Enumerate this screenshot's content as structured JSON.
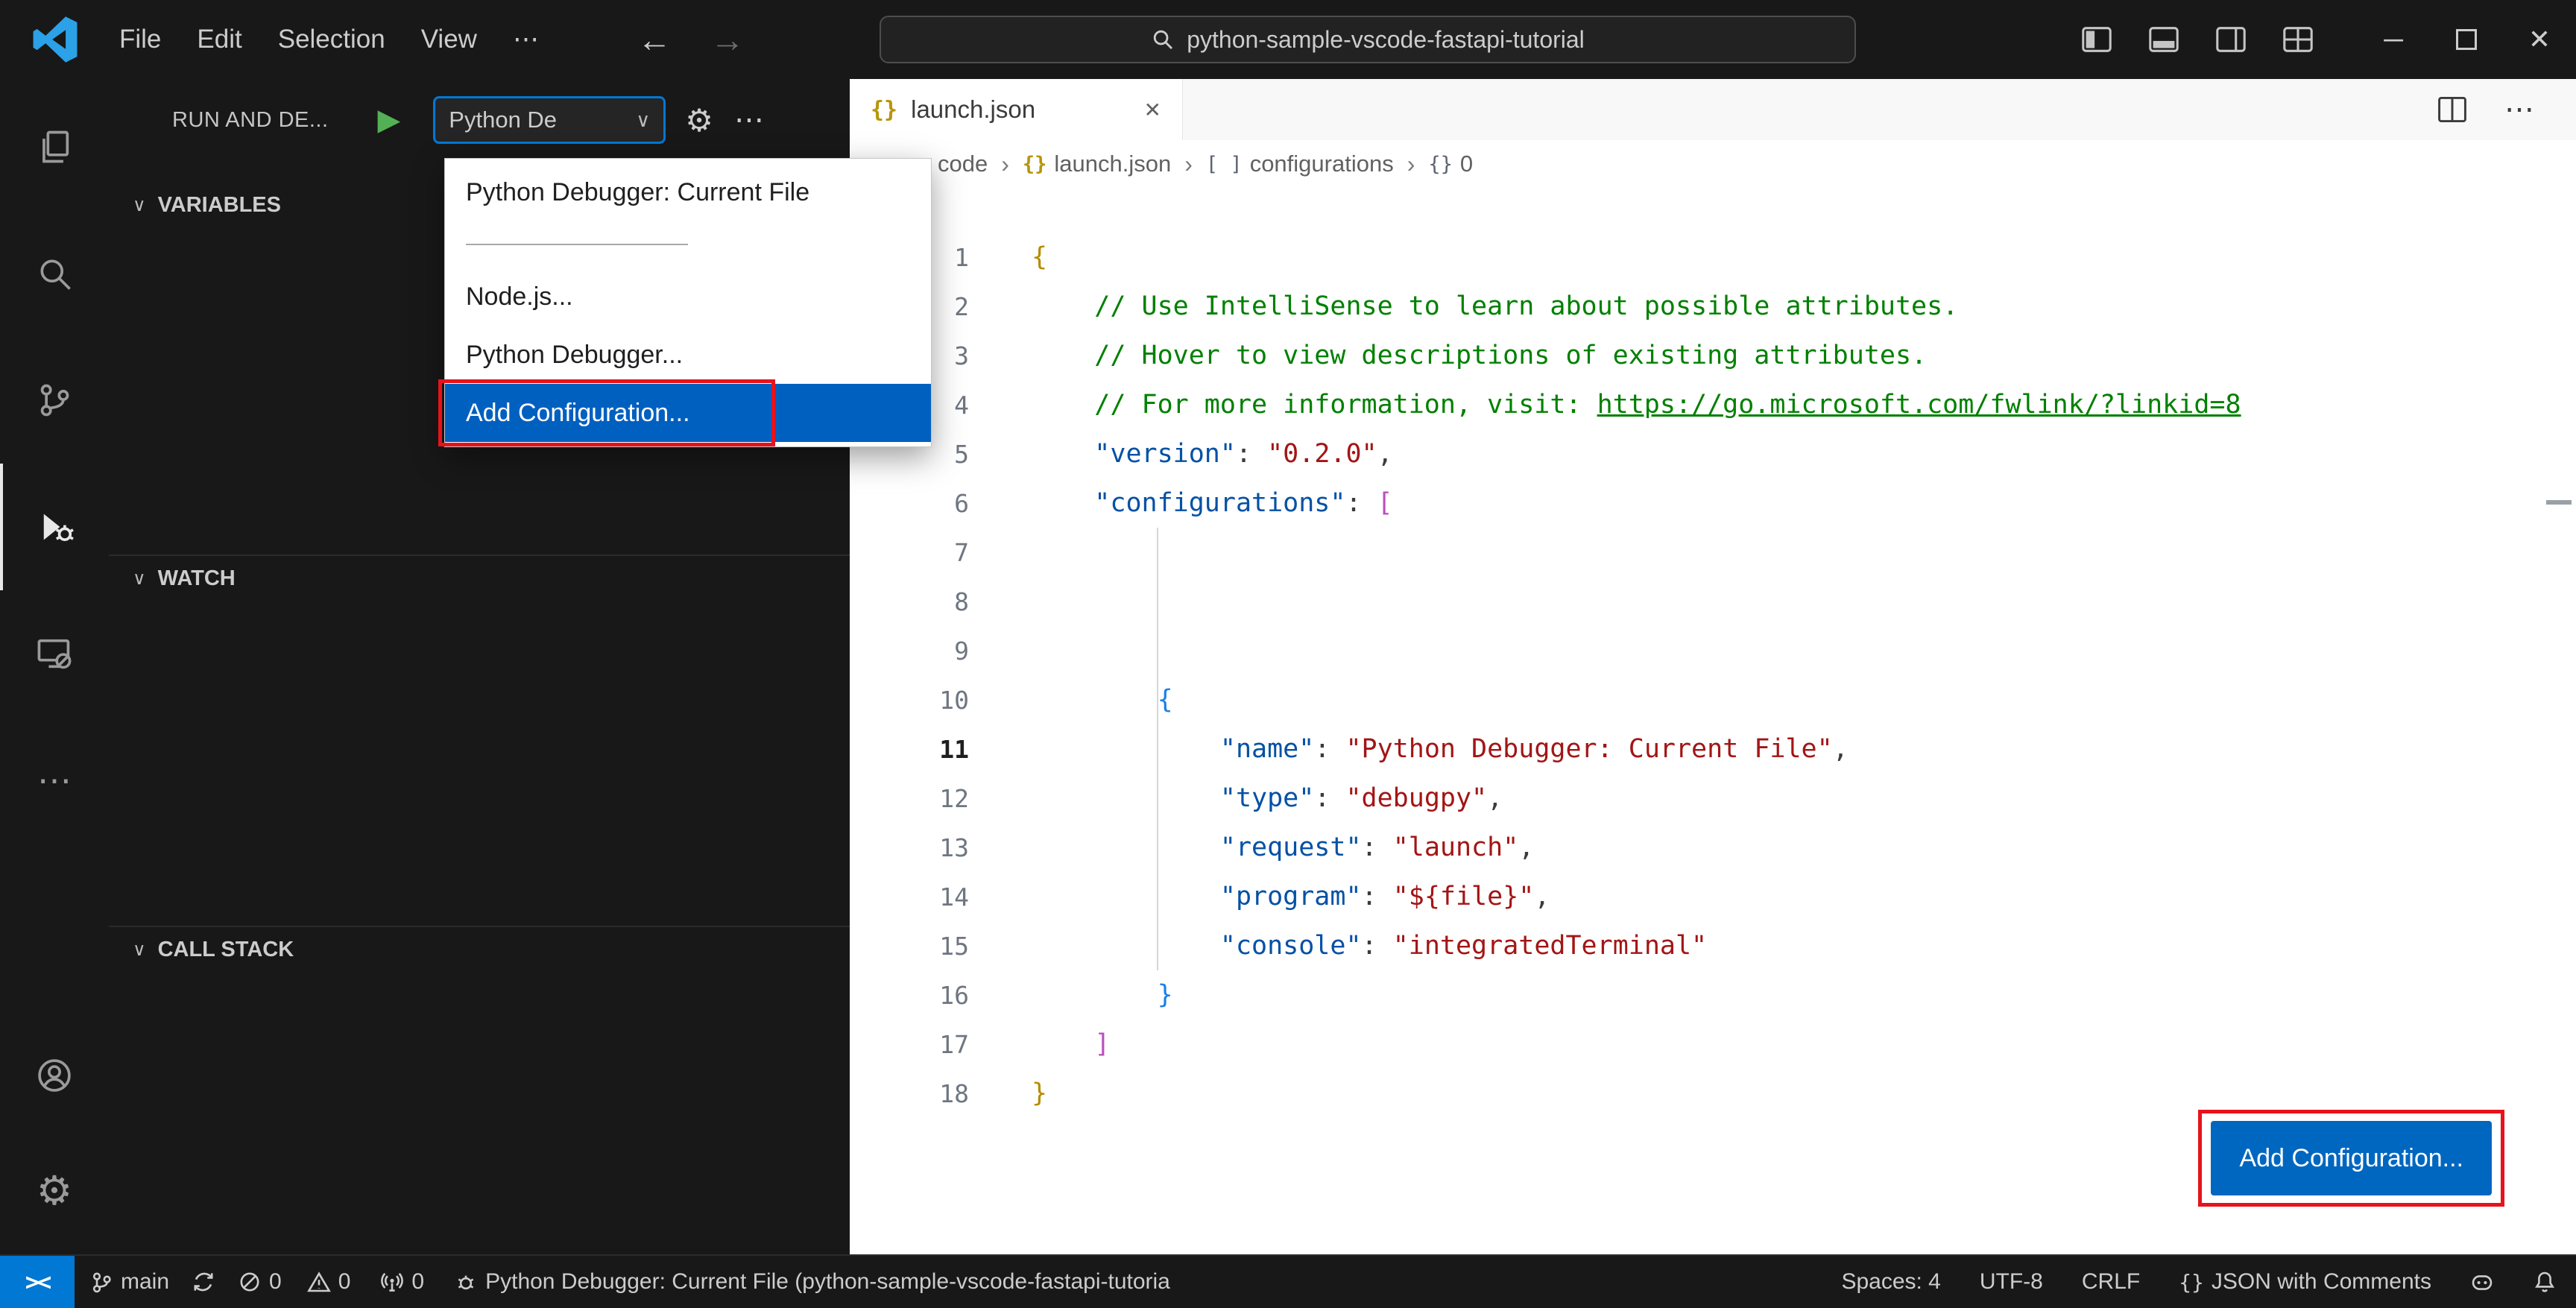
{
  "icons": {
    "more": "⋯",
    "back": "←",
    "forward": "→",
    "minimize": "─",
    "close": "✕",
    "chevron_down": "∨",
    "crumb_sep": "›",
    "braces": "{}",
    "brackets": "[ ]",
    "play": "▶",
    "gear": "⚙",
    "remote": "><",
    "close_tab": "✕"
  },
  "title_bar": {
    "menus": {
      "file": "File",
      "edit": "Edit",
      "selection": "Selection",
      "view": "View"
    },
    "search_value": "python-sample-vscode-fastapi-tutorial"
  },
  "sidebar": {
    "title": "RUN AND DE...",
    "select_value": "Python De",
    "variables": "VARIABLES",
    "watch": "WATCH",
    "call_stack": "CALL STACK"
  },
  "debug_dropdown": {
    "items": [
      {
        "type": "item",
        "label": "Python Debugger: Current File"
      },
      {
        "type": "separator"
      },
      {
        "type": "item",
        "label": "Node.js..."
      },
      {
        "type": "item",
        "label": "Python Debugger..."
      },
      {
        "type": "item",
        "label": "Add Configuration...",
        "selected": true,
        "annotated": true
      }
    ]
  },
  "editor": {
    "tab_label": "launch.json",
    "crumb1": "code",
    "crumb2": "launch.json",
    "crumb3": "configurations",
    "crumb4": "0",
    "add_button": "Add Configuration...",
    "code_lines": [
      {
        "n": "1",
        "tokens": [
          [
            "b1",
            "{"
          ]
        ]
      },
      {
        "n": "2",
        "tokens": [
          [
            "ws",
            "    "
          ],
          [
            "comment",
            "// Use IntelliSense to learn about possible attributes."
          ]
        ]
      },
      {
        "n": "3",
        "tokens": [
          [
            "ws",
            "    "
          ],
          [
            "comment",
            "// Hover to view descriptions of existing attributes."
          ]
        ]
      },
      {
        "n": "4",
        "tokens": [
          [
            "ws",
            "    "
          ],
          [
            "comment",
            "// For more information, visit: "
          ],
          [
            "link",
            "https://go.microsoft.com/fwlink/?linkid=8"
          ]
        ]
      },
      {
        "n": "5",
        "tokens": [
          [
            "ws",
            "    "
          ],
          [
            "key",
            "\"version\""
          ],
          [
            "punct",
            ": "
          ],
          [
            "str",
            "\"0.2.0\""
          ],
          [
            "punct",
            ","
          ]
        ]
      },
      {
        "n": "6",
        "tokens": [
          [
            "ws",
            "    "
          ],
          [
            "key",
            "\"configurations\""
          ],
          [
            "punct",
            ": "
          ],
          [
            "b2",
            "["
          ]
        ]
      },
      {
        "n": "7",
        "tokens": []
      },
      {
        "n": "8",
        "tokens": []
      },
      {
        "n": "9",
        "tokens": []
      },
      {
        "n": "10",
        "tokens": [
          [
            "ws",
            "        "
          ],
          [
            "b3",
            "{"
          ]
        ]
      },
      {
        "n": "11",
        "active": true,
        "tokens": [
          [
            "ws",
            "            "
          ],
          [
            "key",
            "\"name\""
          ],
          [
            "punct",
            ": "
          ],
          [
            "str",
            "\"Python Debugger: Current File\""
          ],
          [
            "punct",
            ","
          ]
        ]
      },
      {
        "n": "12",
        "tokens": [
          [
            "ws",
            "            "
          ],
          [
            "key",
            "\"type\""
          ],
          [
            "punct",
            ": "
          ],
          [
            "str",
            "\"debugpy\""
          ],
          [
            "punct",
            ","
          ]
        ]
      },
      {
        "n": "13",
        "tokens": [
          [
            "ws",
            "            "
          ],
          [
            "key",
            "\"request\""
          ],
          [
            "punct",
            ": "
          ],
          [
            "str",
            "\"launch\""
          ],
          [
            "punct",
            ","
          ]
        ]
      },
      {
        "n": "14",
        "tokens": [
          [
            "ws",
            "            "
          ],
          [
            "key",
            "\"program\""
          ],
          [
            "punct",
            ": "
          ],
          [
            "str",
            "\"${file}\""
          ],
          [
            "punct",
            ","
          ]
        ]
      },
      {
        "n": "15",
        "tokens": [
          [
            "ws",
            "            "
          ],
          [
            "key",
            "\"console\""
          ],
          [
            "punct",
            ": "
          ],
          [
            "str",
            "\"integratedTerminal\""
          ]
        ]
      },
      {
        "n": "16",
        "tokens": [
          [
            "ws",
            "        "
          ],
          [
            "b3",
            "}"
          ]
        ]
      },
      {
        "n": "17",
        "tokens": [
          [
            "ws",
            "    "
          ],
          [
            "b2",
            "]"
          ]
        ]
      },
      {
        "n": "18",
        "tokens": [
          [
            "b1",
            "}"
          ]
        ]
      }
    ]
  },
  "status_bar": {
    "remote": "><",
    "branch": "main",
    "errors": "0",
    "warnings": "0",
    "ports": "0",
    "debug_status": "Python Debugger: Current File (python-sample-vscode-fastapi-tutoria",
    "spaces": "Spaces: 4",
    "encoding": "UTF-8",
    "eol": "CRLF",
    "language": "JSON with Comments"
  }
}
